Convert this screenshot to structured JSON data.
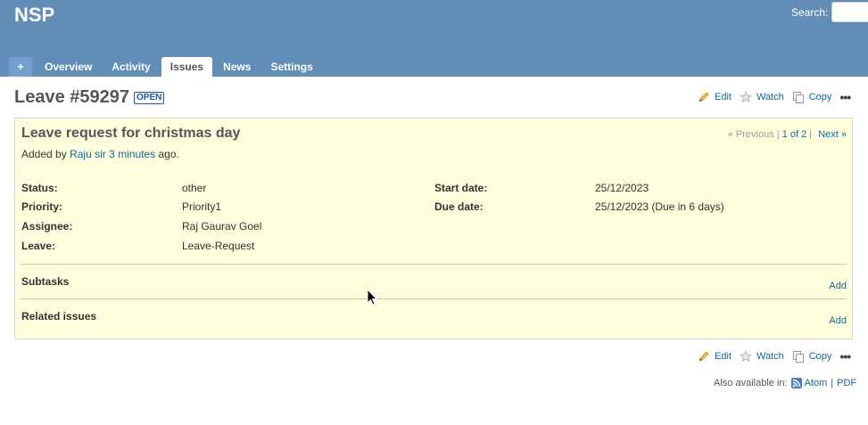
{
  "header": {
    "project_title": "NSP",
    "search_label": "Search:",
    "search_value": ""
  },
  "menu": {
    "new_label": "+",
    "items": [
      {
        "label": "Overview",
        "selected": false
      },
      {
        "label": "Activity",
        "selected": false
      },
      {
        "label": "Issues",
        "selected": true
      },
      {
        "label": "News",
        "selected": false
      },
      {
        "label": "Settings",
        "selected": false
      }
    ]
  },
  "issue": {
    "heading": "Leave #59297",
    "status_badge": "OPEN",
    "subject": "Leave request for christmas day",
    "author_prefix": "Added by",
    "author": "Raju sir",
    "time_ago": "3 minutes",
    "author_suffix": "ago.",
    "nav": {
      "previous": "« Previous",
      "sep1": "|",
      "position": "1 of 2",
      "sep2": "|",
      "next": "Next »"
    },
    "attributes": {
      "status_label": "Status:",
      "status_value": "other",
      "priority_label": "Priority:",
      "priority_value": "Priority1",
      "assignee_label": "Assignee:",
      "assignee_value": "Raj Gaurav Goel",
      "leave_label": "Leave:",
      "leave_value": "Leave-Request",
      "start_date_label": "Start date:",
      "start_date_value": "25/12/2023",
      "due_date_label": "Due date:",
      "due_date_value": "25/12/2023 (Due in 6 days)"
    },
    "subtasks_title": "Subtasks",
    "subtasks_add": "Add",
    "related_title": "Related issues",
    "related_add": "Add"
  },
  "actions": {
    "edit": "Edit",
    "watch": "Watch",
    "copy": "Copy",
    "more": "•••"
  },
  "footer": {
    "also_available": "Also available in:",
    "atom": "Atom",
    "sep": "|",
    "pdf": "PDF"
  },
  "colors": {
    "header_bg": "#628db6",
    "issue_box_bg": "#ffffdd",
    "link": "#116699"
  }
}
